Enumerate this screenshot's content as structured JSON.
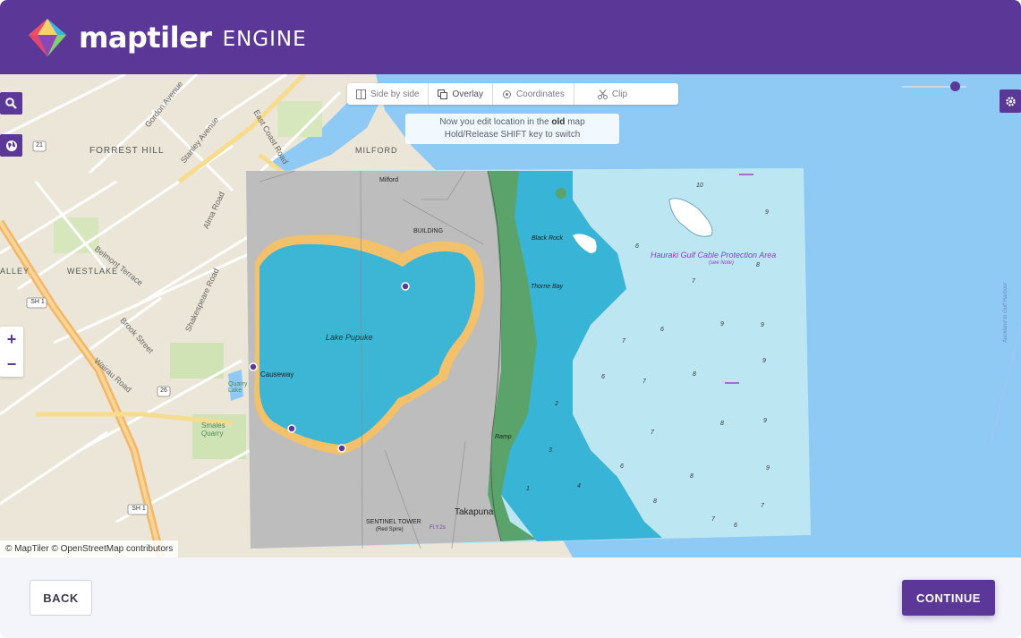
{
  "header": {
    "brand": "maptiler",
    "brand_sub": "ENGINE"
  },
  "toolbar": {
    "items": [
      {
        "label": "Side by side",
        "icon": "columns-icon"
      },
      {
        "label": "Overlay",
        "icon": "overlay-icon"
      },
      {
        "label": "Coordinates",
        "icon": "crosshair-icon"
      },
      {
        "label": "Clip",
        "icon": "scissors-icon"
      }
    ]
  },
  "hint": {
    "line1_pre": "Now you edit location in the ",
    "line1_bold": "old",
    "line1_post": " map",
    "line2": "Hold/Release SHIFT key to switch"
  },
  "map_controls": {
    "zoom_in": "+",
    "zoom_out": "−"
  },
  "map_labels": {
    "forrest_hill": "FORREST HILL",
    "milford": "MILFORD",
    "westlake": "WESTLAKE",
    "alley": "ALLEY",
    "belmont": "Belmont Terrace",
    "brook": "Brook Street",
    "wairau": "Wairau Road",
    "gordon": "Gordon Avenue",
    "stanley": "Stanley Avenue",
    "east_coast": "East Coast Road",
    "alma": "Alma Road",
    "shakespeare": "Shakespeare Road",
    "sh1_a": "SH 1",
    "sh1_b": "SH 1",
    "r21": "21",
    "r26": "26",
    "smales": "Smales Quarry",
    "quarry_lake": "Quarry Lake",
    "lake_pupuke": "Lake Pupuke",
    "causeway": "Causeway",
    "building": "BUILDING",
    "milford_old": "Milford",
    "black_rock": "Black Rock",
    "thorne_bay": "Thorne Bay",
    "takapuna": "Takapuna",
    "sentinel": "SENTINEL TOWER",
    "sentinel_sub": "(Red Spire)",
    "ramp": "Ramp",
    "hauraki": "Hauraki Gulf Cable Protection Area",
    "hauraki_sub": "(see Note)",
    "auckland": "Auckland to Gulf Harbour",
    "flag": "Fl.Y.2s"
  },
  "attribution": "© MapTiler © OpenStreetMap contributors",
  "footer": {
    "back": "BACK",
    "continue": "CONTINUE"
  },
  "colors": {
    "brand": "#5b3797",
    "water": "#8fcaf5",
    "chart_light": "#bde6f3",
    "chart_cyan": "#38b5d6",
    "land_old": "#c0c0c0",
    "sand": "#f3c16a",
    "green": "#5aa36a"
  }
}
